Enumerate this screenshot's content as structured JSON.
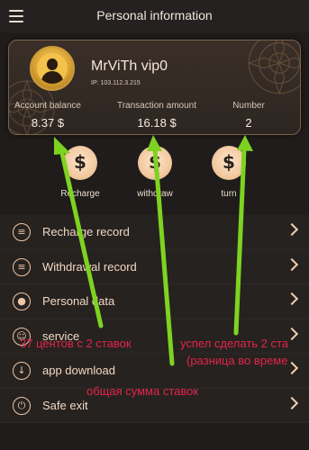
{
  "header": {
    "title": "Personal information",
    "menu_icon": "hamburger-icon"
  },
  "profile": {
    "username": "MrViTh vip0",
    "ip": "IP:  103.112.3.215",
    "avatar_icon": "user-avatar-icon"
  },
  "stats": [
    {
      "label": "Account balance",
      "value": "8.37 $"
    },
    {
      "label": "Transaction amount",
      "value": "16.18 $"
    },
    {
      "label": "Number",
      "value": "2"
    }
  ],
  "actions": [
    {
      "label": "Recharge",
      "icon": "recharge-icon"
    },
    {
      "label": "withdraw",
      "icon": "withdraw-icon"
    },
    {
      "label": "turn",
      "icon": "transfer-icon"
    }
  ],
  "menu": [
    {
      "label": "Recharge record",
      "icon": "recharge-record-icon"
    },
    {
      "label": "Withdrawal record",
      "icon": "withdrawal-record-icon"
    },
    {
      "label": "Personal data",
      "icon": "person-icon"
    },
    {
      "label": "service",
      "icon": "service-icon"
    },
    {
      "label": "app download",
      "icon": "download-icon"
    },
    {
      "label": "Safe exit",
      "icon": "power-icon"
    }
  ],
  "annotations": [
    {
      "text": "37 центов с 2 ставок"
    },
    {
      "text": "успел сделать 2 ста"
    },
    {
      "text": "(разница во време"
    },
    {
      "text": "общая сумма ставок"
    }
  ],
  "colors": {
    "background": "#1f1c1b",
    "accent": "#f2c9a0",
    "arrow": "#7ed321",
    "annotation": "#e2254a"
  }
}
